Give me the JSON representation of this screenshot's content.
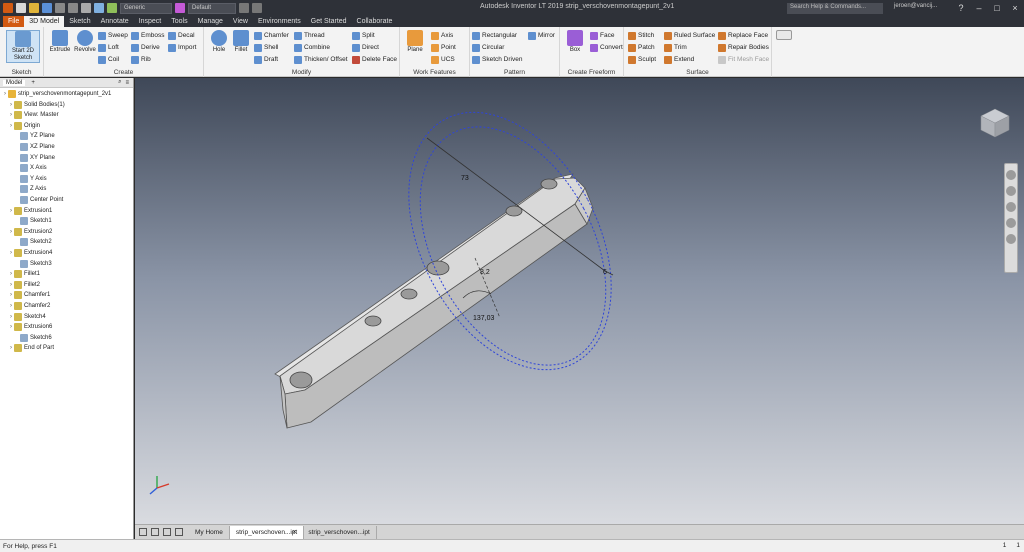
{
  "titlebar": {
    "app_title": "Autodesk Inventor LT 2019   strip_verschovenmontagepunt_2v1",
    "appearance_dropdown": "Generic",
    "material_dropdown": "Default",
    "search_placeholder": "Search Help & Commands...",
    "user": "jeroen@vancij...",
    "help": "?"
  },
  "tabs": [
    "File",
    "3D Model",
    "Sketch",
    "Annotate",
    "Inspect",
    "Tools",
    "Manage",
    "View",
    "Environments",
    "Get Started",
    "Collaborate"
  ],
  "ribbon": {
    "sketch": {
      "label": "Sketch",
      "start_sketch": "Start 2D Sketch"
    },
    "create": {
      "label": "Create",
      "extrude": "Extrude",
      "revolve": "Revolve",
      "sweep": "Sweep",
      "emboss": "Emboss",
      "decal": "Decal",
      "loft": "Loft",
      "derive": "Derive",
      "import": "Import",
      "coil": "Coil",
      "rib": "Rib"
    },
    "modify": {
      "label": "Modify",
      "hole": "Hole",
      "fillet": "Fillet",
      "chamfer": "Chamfer",
      "thread": "Thread",
      "split": "Split",
      "shell": "Shell",
      "combine": "Combine",
      "direct": "Direct",
      "draft": "Draft",
      "thicken": "Thicken/ Offset",
      "delete_face": "Delete Face"
    },
    "work": {
      "label": "Work Features",
      "plane": "Plane",
      "axis": "Axis",
      "point": "Point",
      "ucs": "UCS"
    },
    "pattern": {
      "label": "Pattern",
      "rectangular": "Rectangular",
      "circular": "Circular",
      "sketch_driven": "Sketch Driven",
      "mirror": "Mirror"
    },
    "freeform": {
      "label": "Create Freeform",
      "box": "Box",
      "face": "Face",
      "convert": "Convert"
    },
    "surface": {
      "label": "Surface",
      "stitch": "Stitch",
      "ruled": "Ruled Surface",
      "replace": "Replace Face",
      "patch": "Patch",
      "trim": "Trim",
      "repair": "Repair Bodies",
      "sculpt": "Sculpt",
      "extend": "Extend",
      "fit_mesh": "Fit Mesh Face"
    }
  },
  "browser": {
    "tabs": [
      "Model",
      "+"
    ],
    "items": [
      {
        "label": "strip_verschovenmontagepunt_2v1",
        "level": 0
      },
      {
        "label": "Solid Bodies(1)",
        "level": 1
      },
      {
        "label": "View: Master",
        "level": 1
      },
      {
        "label": "Origin",
        "level": 1
      },
      {
        "label": "YZ Plane",
        "level": 2
      },
      {
        "label": "XZ Plane",
        "level": 2
      },
      {
        "label": "XY Plane",
        "level": 2
      },
      {
        "label": "X Axis",
        "level": 2
      },
      {
        "label": "Y Axis",
        "level": 2
      },
      {
        "label": "Z Axis",
        "level": 2
      },
      {
        "label": "Center Point",
        "level": 2
      },
      {
        "label": "Extrusion1",
        "level": 1
      },
      {
        "label": "Sketch1",
        "level": 2
      },
      {
        "label": "Extrusion2",
        "level": 1
      },
      {
        "label": "Sketch2",
        "level": 2
      },
      {
        "label": "Extrusion4",
        "level": 1
      },
      {
        "label": "Sketch3",
        "level": 2
      },
      {
        "label": "Fillet1",
        "level": 1
      },
      {
        "label": "Fillet2",
        "level": 1
      },
      {
        "label": "Chamfer1",
        "level": 1
      },
      {
        "label": "Chamfer2",
        "level": 1
      },
      {
        "label": "Sketch4",
        "level": 1
      },
      {
        "label": "Extrusion6",
        "level": 1
      },
      {
        "label": "Sketch6",
        "level": 2
      },
      {
        "label": "End of Part",
        "level": 1
      }
    ]
  },
  "viewport": {
    "dimensions": {
      "d1": "73",
      "d2": "8,2",
      "d3": "137,03",
      "d4": "6"
    }
  },
  "doctabs": [
    "My Home",
    "strip_verschoven...ipt",
    "strip_verschoven...ipt"
  ],
  "statusbar": {
    "help": "For Help, press F1",
    "count1": "1",
    "count2": "1"
  }
}
